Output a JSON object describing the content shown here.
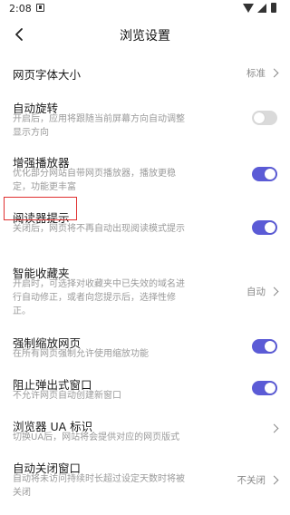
{
  "status_bar": {
    "time": "2:08"
  },
  "header": {
    "title": "浏览设置"
  },
  "settings": {
    "font_size": {
      "title": "网页字体大小",
      "value": "标准"
    },
    "auto_rotate": {
      "title": "自动旋转",
      "desc": "开启后，应用将跟随当前屏幕方向自动调整显示方向",
      "enabled": false
    },
    "enhanced_player": {
      "title": "增强播放器",
      "desc": "优化部分网站自带网页播放器，播放更稳定，功能更丰富",
      "enabled": true
    },
    "reader_prompt": {
      "title": "阅读器提示",
      "desc": "关闭后，网页将不再自动出现阅读模式提示",
      "enabled": true
    },
    "smart_bookmarks": {
      "title": "智能收藏夹",
      "desc": "开启时，可选择对收藏夹中已失效的域名进行自动修正，或者向您提示后，选择性修正。",
      "value": "自动"
    },
    "force_zoom": {
      "title": "强制缩放网页",
      "desc": "在所有网页强制允许使用缩放功能",
      "enabled": true
    },
    "block_popups": {
      "title": "阻止弹出式窗口",
      "desc": "不允许网页自动创建新窗口",
      "enabled": true
    },
    "user_agent": {
      "title": "浏览器 UA 标识",
      "desc": "切换UA后，网站将会提供对应的网页版式"
    },
    "auto_close_tabs": {
      "title": "自动关闭窗口",
      "desc": "自动将未访问持续时长超过设定天数时将被关闭",
      "value": "不关闭"
    }
  },
  "colors": {
    "accent": "#5b5bd6",
    "toggle_off": "#dadada",
    "highlight": "#e03030"
  }
}
